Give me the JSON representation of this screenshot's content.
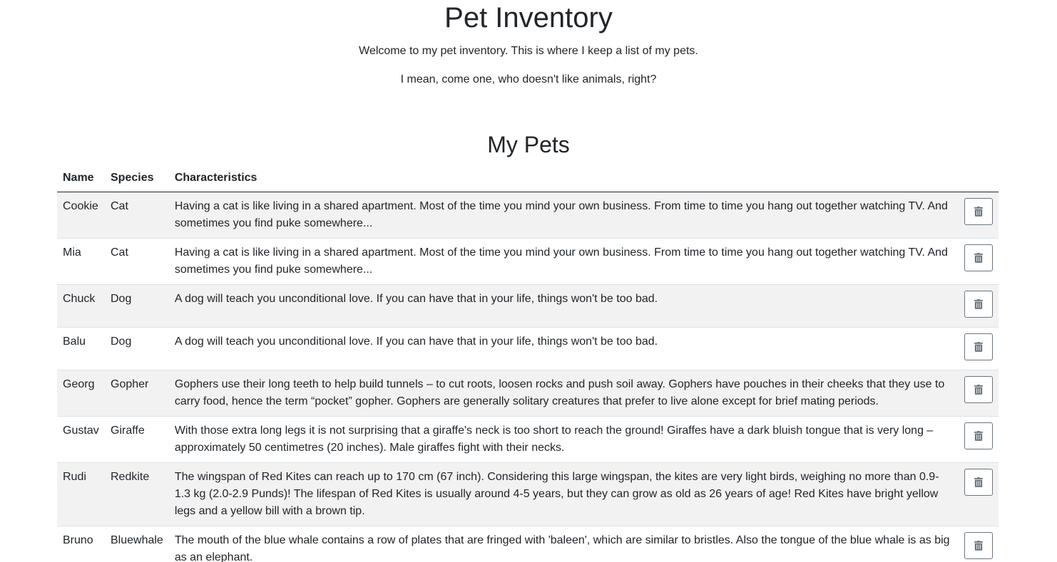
{
  "header": {
    "title": "Pet Inventory",
    "intro": "Welcome to my pet inventory. This is where I keep a list of my pets.",
    "quip": "I mean, come one, who doesn't like animals, right?"
  },
  "section": {
    "title": "My Pets"
  },
  "table": {
    "columns": {
      "name": "Name",
      "species": "Species",
      "characteristics": "Characteristics"
    },
    "rows": [
      {
        "name": "Cookie",
        "species": "Cat",
        "characteristics": "Having a cat is like living in a shared apartment. Most of the time you mind your own business. From time to time you hang out together watching TV. And sometimes you find puke somewhere..."
      },
      {
        "name": "Mia",
        "species": "Cat",
        "characteristics": "Having a cat is like living in a shared apartment. Most of the time you mind your own business. From time to time you hang out together watching TV. And sometimes you find puke somewhere..."
      },
      {
        "name": "Chuck",
        "species": "Dog",
        "characteristics": "A dog will teach you unconditional love. If you can have that in your life, things won't be too bad."
      },
      {
        "name": "Balu",
        "species": "Dog",
        "characteristics": "A dog will teach you unconditional love. If you can have that in your life, things won't be too bad."
      },
      {
        "name": "Georg",
        "species": "Gopher",
        "characteristics": "Gophers use their long teeth to help build tunnels – to cut roots, loosen rocks and push soil away. Gophers have pouches in their cheeks that they use to carry food, hence the term “pocket” gopher. Gophers are generally solitary creatures that prefer to live alone except for brief mating periods."
      },
      {
        "name": "Gustav",
        "species": "Giraffe",
        "characteristics": "With those extra long legs it is not surprising that a giraffe's neck is too short to reach the ground! Giraffes have a dark bluish tongue that is very long – approximately 50 centimetres (20 inches). Male giraffes fight with their necks."
      },
      {
        "name": "Rudi",
        "species": "Redkite",
        "characteristics": "The wingspan of Red Kites can reach up to 170 cm (67 inch). Considering this large wingspan, the kites are very light birds, weighing no more than 0.9-1.3 kg (2.0-2.9 Punds)! The lifespan of Red Kites is usually around 4-5 years, but they can grow as old as 26 years of age! Red Kites have bright yellow legs and a yellow bill with a brown tip."
      },
      {
        "name": "Bruno",
        "species": "Bluewhale",
        "characteristics": "The mouth of the blue whale contains a row of plates that are fringed with 'baleen', which are similar to bristles. Also the tongue of the blue whale is as big as an elephant."
      }
    ],
    "delete_icon": "trash-icon"
  },
  "colors": {
    "text": "#212529",
    "stripe": "#f2f2f2",
    "button_border": "#6c757d",
    "icon": "#6c757d"
  }
}
